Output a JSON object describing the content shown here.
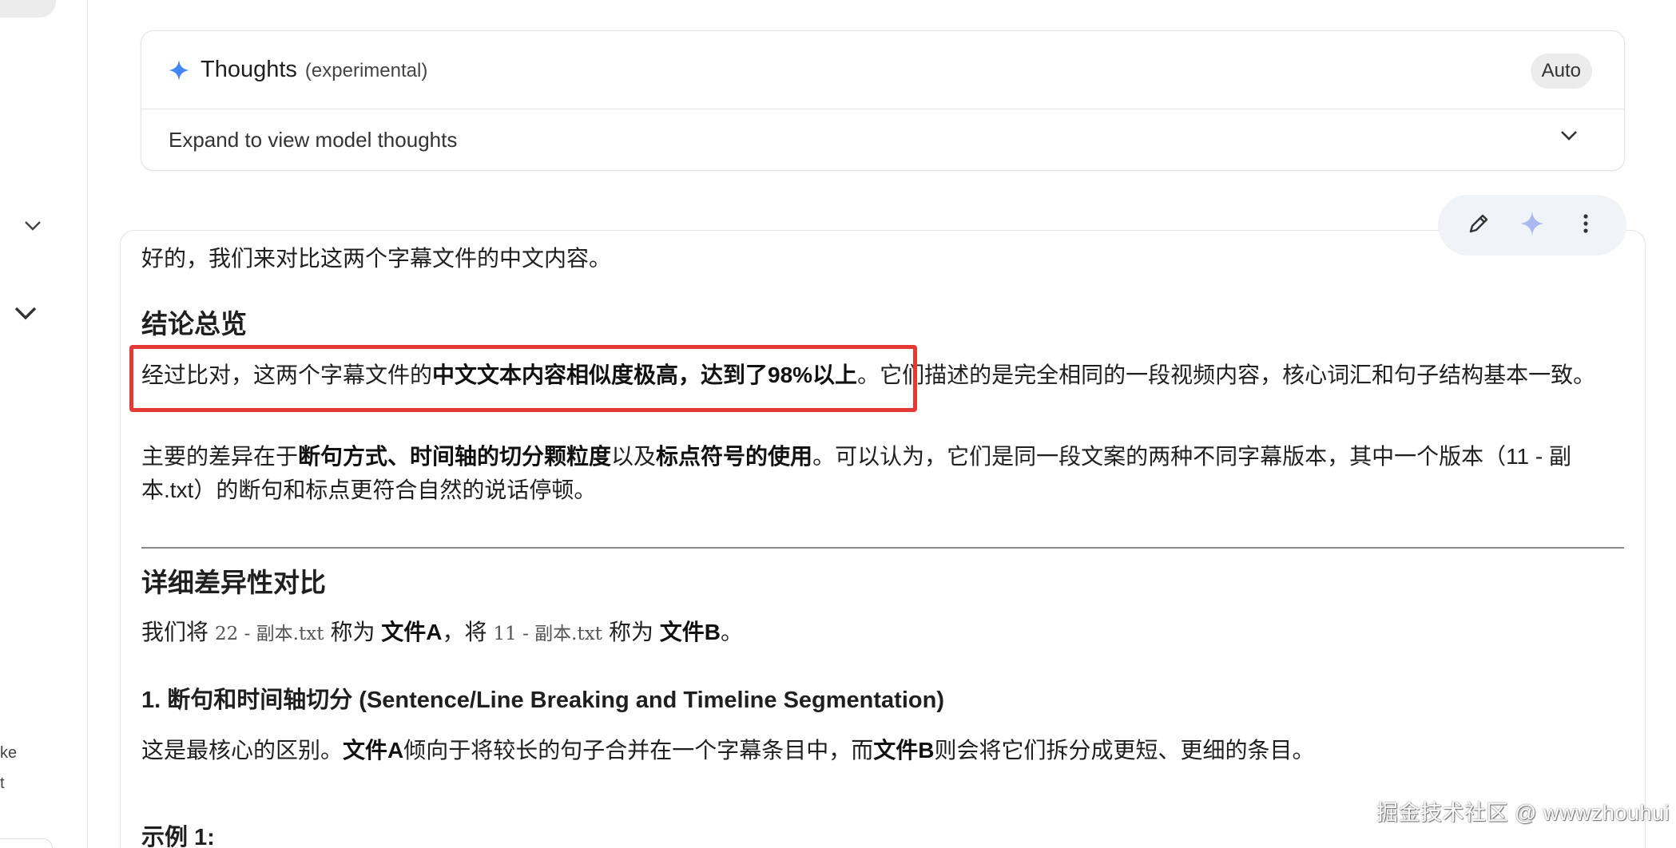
{
  "sidebar": {
    "partial_text_1": "ke",
    "partial_text_2": "t"
  },
  "thoughts": {
    "title": "Thoughts",
    "subtitle": "(experimental)",
    "mode_chip": "Auto",
    "expand_label": "Expand to view model thoughts"
  },
  "toolbar": {
    "icons": [
      "pencil-icon",
      "sparkle-icon",
      "more-vert-icon"
    ]
  },
  "response": {
    "intro": "好的，我们来对比这两个字幕文件的中文内容。",
    "h_overview": "结论总览",
    "p1_a": "经过比对，这两个字幕文件的",
    "p1_bold": "中文文本内容相似度极高，达到了98%以上",
    "p1_b": "。它们描述的是完全相同的一段视频内容，核心词汇和句子结构基本一致。",
    "p2_a": "主要的差异在于",
    "p2_bold1": "断句方式、时间轴的切分颗粒度",
    "p2_b": "以及",
    "p2_bold2": "标点符号的使用",
    "p2_c": "。可以认为，它们是同一段文案的两种不同字幕版本，其中一个版本（11 - 副本.txt）的断句和标点更符合自然的说话停顿。",
    "h_detail": "详细差异性对比",
    "p3_a": "我们将",
    "p3_code1": "22 - 副本.txt",
    "p3_b": "称为",
    "p3_bold1": "文件A",
    "p3_c": "，将",
    "p3_code2": "11 - 副本.txt",
    "p3_d": "称为",
    "p3_bold2": "文件B",
    "p3_e": "。",
    "h_section1": "1. 断句和时间轴切分 (Sentence/Line Breaking and Timeline Segmentation)",
    "p4_a": "这是最核心的区别。",
    "p4_bold1": "文件A",
    "p4_b": "倾向于将较长的句子合并在一个字幕条目中，而",
    "p4_bold2": "文件B",
    "p4_c": "则会将它们拆分成更短、更细的条目。",
    "h_example": "示例 1:"
  },
  "watermark": "掘金技术社区 @ wwwzhouhui",
  "colors": {
    "highlight_box": "#e53935",
    "spark_blue": "#4285f4",
    "toolbar_bg": "#f0f4f9"
  }
}
